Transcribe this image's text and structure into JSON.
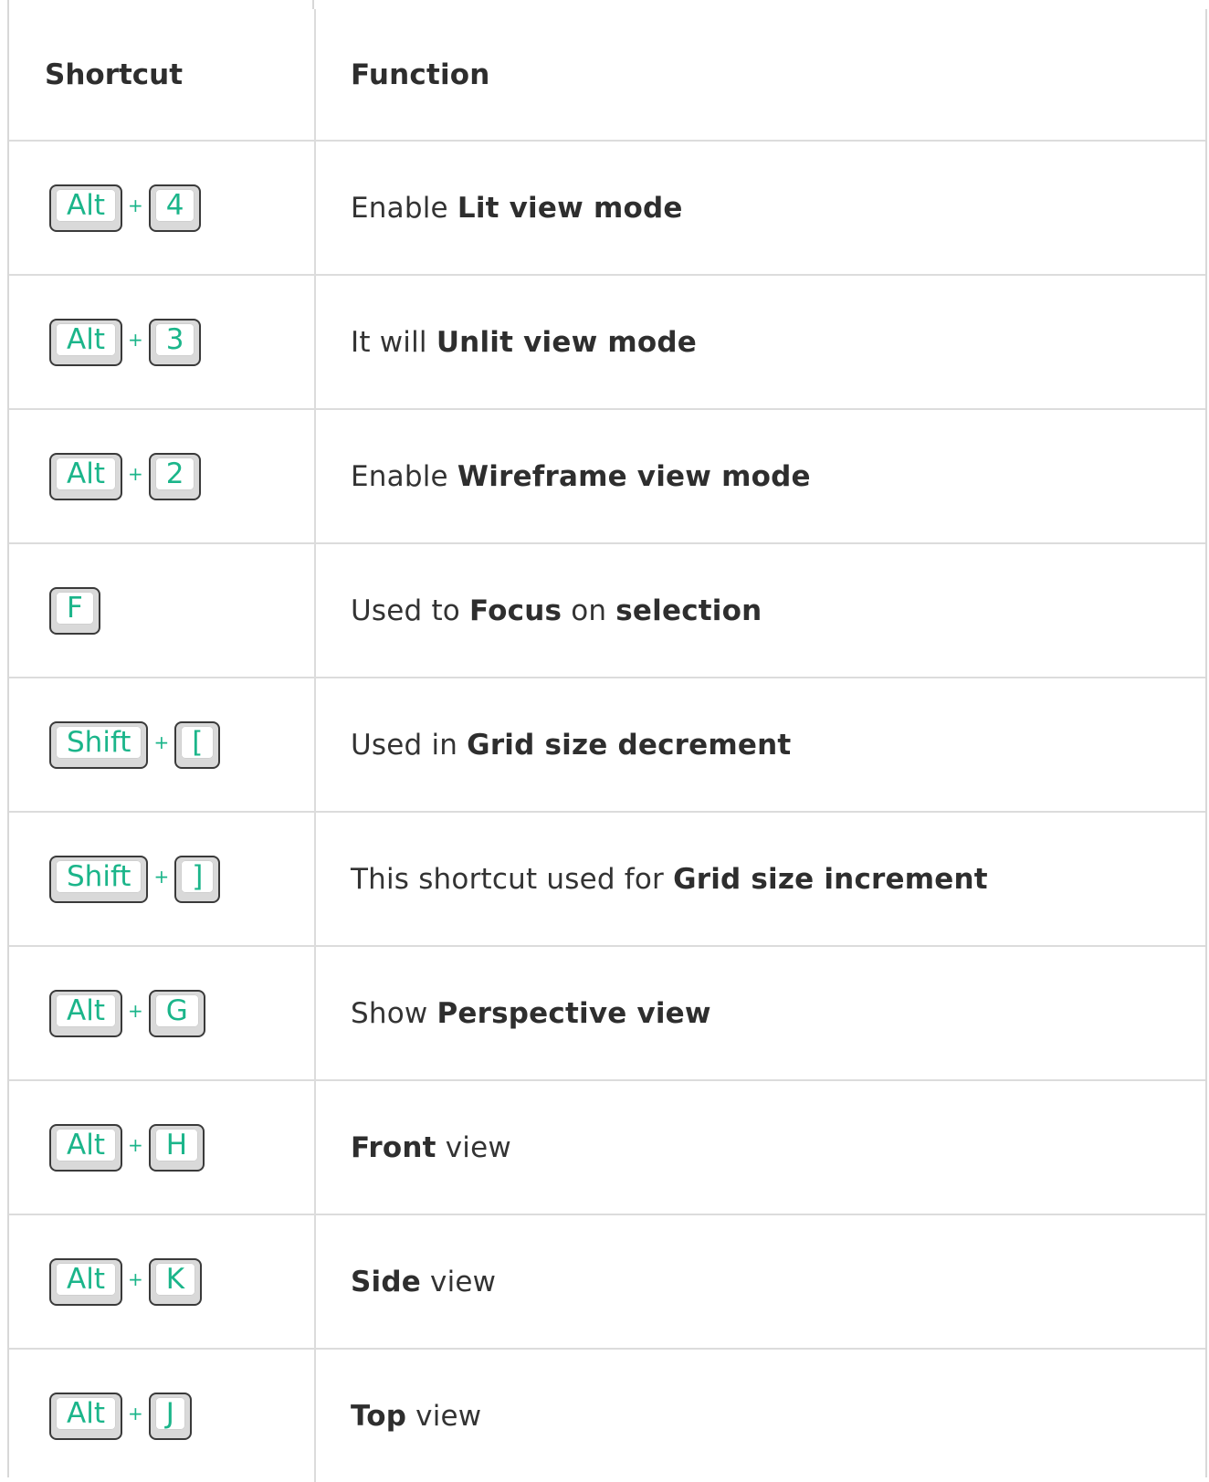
{
  "header": {
    "shortcut": "Shortcut",
    "function": "Function"
  },
  "rows": [
    {
      "keys": [
        "Alt",
        "4"
      ],
      "fn": [
        {
          "t": "Enable ",
          "b": false
        },
        {
          "t": "Lit view mode",
          "b": true
        }
      ]
    },
    {
      "keys": [
        "Alt",
        "3"
      ],
      "fn": [
        {
          "t": "It will ",
          "b": false
        },
        {
          "t": "Unlit view mode",
          "b": true
        }
      ]
    },
    {
      "keys": [
        "Alt",
        "2"
      ],
      "fn": [
        {
          "t": "Enable ",
          "b": false
        },
        {
          "t": "Wireframe view mode",
          "b": true
        }
      ]
    },
    {
      "keys": [
        "F"
      ],
      "fn": [
        {
          "t": "Used to ",
          "b": false
        },
        {
          "t": "Focus",
          "b": true
        },
        {
          "t": " on ",
          "b": false
        },
        {
          "t": "selection",
          "b": true
        }
      ]
    },
    {
      "keys": [
        "Shift",
        "["
      ],
      "fn": [
        {
          "t": "Used in ",
          "b": false
        },
        {
          "t": "Grid size decrement",
          "b": true
        }
      ]
    },
    {
      "keys": [
        "Shift",
        "]"
      ],
      "fn": [
        {
          "t": "This shortcut used for ",
          "b": false
        },
        {
          "t": "Grid size increment",
          "b": true
        }
      ]
    },
    {
      "keys": [
        "Alt",
        "G"
      ],
      "fn": [
        {
          "t": "Show ",
          "b": false
        },
        {
          "t": "Perspective view",
          "b": true
        }
      ]
    },
    {
      "keys": [
        "Alt",
        "H"
      ],
      "fn": [
        {
          "t": "Front",
          "b": true
        },
        {
          "t": " view",
          "b": false
        }
      ]
    },
    {
      "keys": [
        "Alt",
        "K"
      ],
      "fn": [
        {
          "t": "Side",
          "b": true
        },
        {
          "t": " view",
          "b": false
        }
      ]
    },
    {
      "keys": [
        "Alt",
        "J"
      ],
      "fn": [
        {
          "t": "Top",
          "b": true
        },
        {
          "t": " view",
          "b": false
        }
      ]
    }
  ],
  "plus_sign": "+",
  "colors": {
    "key_label": "#1bb58a",
    "border": "#dcdcdc",
    "text": "#333333"
  }
}
